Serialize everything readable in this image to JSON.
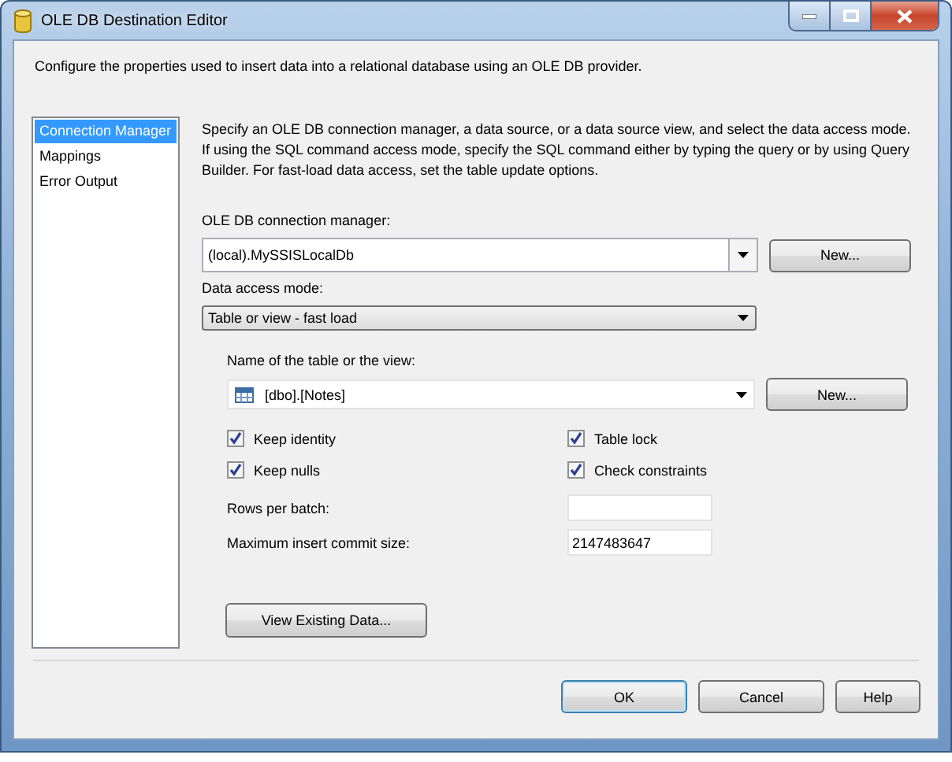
{
  "window": {
    "title": "OLE DB Destination Editor"
  },
  "description": "Configure the properties used to insert data into a relational database using an OLE DB provider.",
  "nav": {
    "items": [
      {
        "label": "Connection Manager",
        "selected": true
      },
      {
        "label": "Mappings",
        "selected": false
      },
      {
        "label": "Error Output",
        "selected": false
      }
    ]
  },
  "intro": "Specify an OLE DB connection manager, a data source, or a data source view, and select the data access mode. If using the SQL command access mode, specify the SQL command either by typing the query or by using Query Builder. For fast-load data access, set the table update options.",
  "connection_manager": {
    "label": "OLE DB connection manager:",
    "value": "(local).MySSISLocalDb",
    "button": "New..."
  },
  "data_access_mode": {
    "label": "Data access mode:",
    "value": "Table or view - fast load"
  },
  "table": {
    "label": "Name of the table or the view:",
    "value": "[dbo].[Notes]",
    "button": "New..."
  },
  "options": [
    {
      "label": "Keep identity",
      "checked": true
    },
    {
      "label": "Table lock",
      "checked": true
    },
    {
      "label": "Keep nulls",
      "checked": true
    },
    {
      "label": "Check constraints",
      "checked": true
    }
  ],
  "fields": [
    {
      "label": "Rows per batch:"
    },
    {
      "label": "Maximum insert commit size:",
      "value": "2147483647"
    }
  ],
  "view_button": "View Existing Data...",
  "buttons": [
    {
      "label": "OK",
      "default": true
    },
    {
      "label": "Cancel",
      "default": false
    },
    {
      "label": "Help",
      "default": false
    }
  ]
}
